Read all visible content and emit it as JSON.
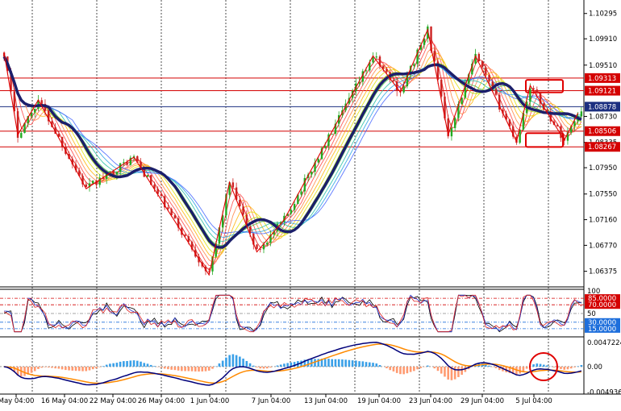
{
  "chart_data": {
    "type": "candlestick",
    "symbol": "",
    "main": {
      "y_ticks": [
        "1.10295",
        "1.09910",
        "1.09510",
        "1.08730",
        "1.08335",
        "1.07950",
        "1.07550",
        "1.07160",
        "1.06770",
        "1.06375"
      ],
      "y_range": [
        1.0615,
        1.105
      ],
      "price_lines": [
        {
          "label": "1.09313",
          "value": 1.09313,
          "color": "#d40000"
        },
        {
          "label": "1.09121",
          "value": 1.09121,
          "color": "#d40000"
        },
        {
          "label": "1.08878",
          "value": 1.08878,
          "color": "#1c2f80"
        },
        {
          "label": "1.08506",
          "value": 1.08506,
          "color": "#d40000"
        },
        {
          "label": "1.08267",
          "value": 1.08267,
          "color": "#d40000"
        }
      ],
      "highlight_boxes": [
        {
          "name": "upper-box",
          "price_top": 1.0931,
          "price_bottom": 1.0912
        },
        {
          "name": "lower-box",
          "price_top": 1.085,
          "price_bottom": 1.0829
        }
      ],
      "zigzag": [
        [
          0,
          1.097
        ],
        [
          4,
          1.0845
        ],
        [
          10,
          1.0898
        ],
        [
          24,
          1.0763
        ],
        [
          38,
          1.0811
        ],
        [
          60,
          1.0632
        ],
        [
          66,
          1.0773
        ],
        [
          74,
          1.0667
        ],
        [
          82,
          1.0716
        ],
        [
          108,
          1.0965
        ],
        [
          116,
          1.091
        ],
        [
          124,
          1.1005
        ],
        [
          130,
          1.0845
        ],
        [
          138,
          1.0965
        ],
        [
          150,
          1.0835
        ],
        [
          154,
          1.092
        ],
        [
          164,
          1.0837
        ],
        [
          168,
          1.0878
        ]
      ],
      "ma_colors": [
        "#e00000",
        "#ff4040",
        "#ff8040",
        "#ffb000",
        "#e0e000",
        "#a0e000",
        "#40c040",
        "#20c0a0",
        "#20a0e0",
        "#4060ff"
      ],
      "slow_ma_color": "#1c1f6b"
    },
    "rsi": {
      "levels": [
        {
          "label": "85.0000",
          "value": 85,
          "color": "#d40000"
        },
        {
          "label": "70.0000",
          "value": 70,
          "color": "#d40000"
        },
        {
          "label": "50",
          "value": 50,
          "color": "#888888"
        },
        {
          "label": "30.0000",
          "value": 30,
          "color": "#1e6fdc"
        },
        {
          "label": "15.0000",
          "value": 15,
          "color": "#1e6fdc"
        }
      ],
      "top_label": "100"
    },
    "macd": {
      "labels": [
        "0.0047224",
        "0.00",
        "-0.004936"
      ],
      "range": [
        -0.0052,
        0.0055
      ]
    },
    "x_ticks": [
      "May 04:00",
      "16 May 04:00",
      "22 May 04:00",
      "26 May 04:00",
      "1 Jun 04:00",
      "7 Jun 04:00",
      "13 Jun 04:00",
      "19 Jun 04:00",
      "23 Jun 04:00",
      "29 Jun 04:00",
      "5 Jul 04:00"
    ],
    "candle_count": 170,
    "colors": {
      "bull": "#22aa22",
      "bear": "#cc2222",
      "grid": "#000000",
      "hist_pos": "#3aa0e8",
      "hist_neg": "#ff9a70",
      "macd_line": "#00007a",
      "signal_line": "#ff8a00",
      "circle": "#e00000"
    }
  }
}
